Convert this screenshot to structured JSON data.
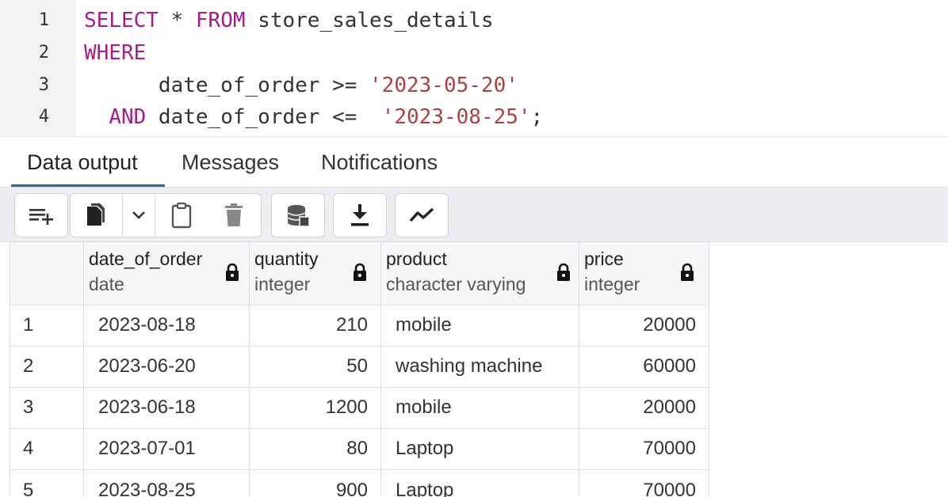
{
  "editor": {
    "lines": [
      {
        "num": "1",
        "tokens": [
          [
            "kw",
            "SELECT"
          ],
          [
            "op",
            " * "
          ],
          [
            "kw",
            "FROM"
          ],
          [
            "op",
            " store_sales_details"
          ]
        ]
      },
      {
        "num": "2",
        "tokens": [
          [
            "kw",
            "WHERE"
          ]
        ]
      },
      {
        "num": "3",
        "tokens": [
          [
            "op",
            "      date_of_order >= "
          ],
          [
            "str",
            "'2023-05-20'"
          ]
        ]
      },
      {
        "num": "4",
        "tokens": [
          [
            "op",
            "  "
          ],
          [
            "kw",
            "AND"
          ],
          [
            "op",
            " date_of_order <=  "
          ],
          [
            "str",
            "'2023-08-25'"
          ],
          [
            "op",
            ";"
          ]
        ]
      }
    ]
  },
  "tabs": [
    {
      "label": "Data output",
      "active": true
    },
    {
      "label": "Messages",
      "active": false
    },
    {
      "label": "Notifications",
      "active": false
    }
  ],
  "toolbar": {
    "icons": [
      "add-row-icon",
      "copy-icon",
      "chevron-down-icon",
      "paste-icon",
      "delete-icon",
      "save-data-icon",
      "download-icon",
      "graph-icon"
    ]
  },
  "grid": {
    "columns": [
      {
        "name": "date_of_order",
        "type": "date"
      },
      {
        "name": "quantity",
        "type": "integer"
      },
      {
        "name": "product",
        "type": "character varying"
      },
      {
        "name": "price",
        "type": "integer"
      }
    ],
    "rows": [
      {
        "n": "1",
        "date_of_order": "2023-08-18",
        "quantity": "210",
        "product": "mobile",
        "price": "20000"
      },
      {
        "n": "2",
        "date_of_order": "2023-06-20",
        "quantity": "50",
        "product": "washing machine",
        "price": "60000"
      },
      {
        "n": "3",
        "date_of_order": "2023-06-18",
        "quantity": "1200",
        "product": "mobile",
        "price": "20000"
      },
      {
        "n": "4",
        "date_of_order": "2023-07-01",
        "quantity": "80",
        "product": "Laptop",
        "price": "70000"
      },
      {
        "n": "5",
        "date_of_order": "2023-08-25",
        "quantity": "900",
        "product": "Laptop",
        "price": "70000"
      }
    ]
  }
}
